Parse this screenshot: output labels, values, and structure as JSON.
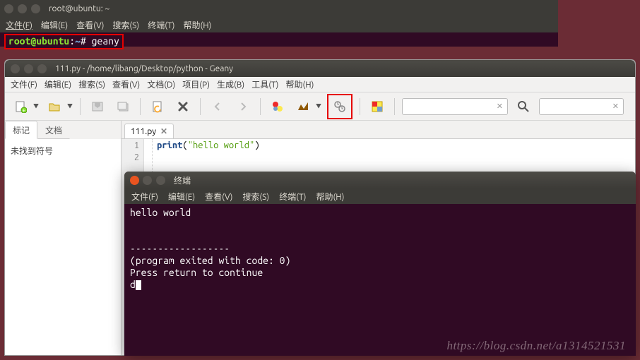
{
  "term1": {
    "title": "root@ubuntu: ~",
    "menu": [
      "文件(F)",
      "编辑(E)",
      "查看(V)",
      "搜索(S)",
      "终端(T)",
      "帮助(H)"
    ],
    "prompt_user": "root@ubuntu",
    "prompt_colon": ":",
    "prompt_path": "~",
    "prompt_hash": "#",
    "command": "geany"
  },
  "geany": {
    "title": "111.py - /home/libang/Desktop/python - Geany",
    "menu": [
      "文件(F)",
      "编辑(E)",
      "搜索(S)",
      "查看(V)",
      "文档(D)",
      "项目(P)",
      "生成(B)",
      "工具(T)",
      "帮助(H)"
    ],
    "sidebar_tabs": {
      "active": "标记",
      "other": "文档"
    },
    "sidebar_msg": "未找到符号",
    "editor_tab": "111.py",
    "code": {
      "line1_kw": "print",
      "line1_open": "(",
      "line1_str": "\"hello world\"",
      "line1_close": ")"
    },
    "line_numbers": [
      "1",
      "2"
    ],
    "search_clear": "✕"
  },
  "term2": {
    "title": "终端",
    "menu": [
      "文件(F)",
      "编辑(E)",
      "查看(V)",
      "搜索(S)",
      "终端(T)",
      "帮助(H)"
    ],
    "output": "hello world\n\n\n------------------\n(program exited with code: 0)\nPress return to continue\nd"
  },
  "watermark": "https://blog.csdn.net/a1314521531"
}
